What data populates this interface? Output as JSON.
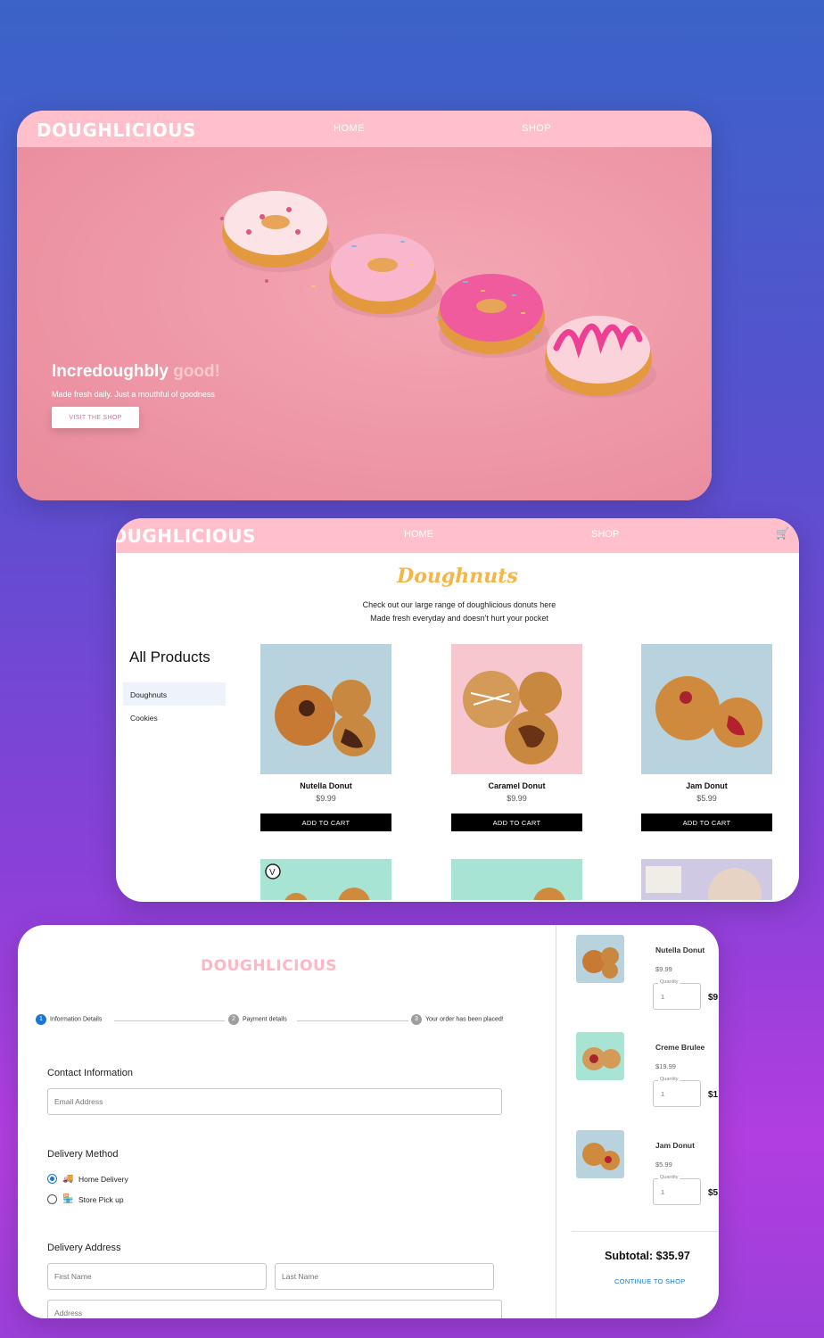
{
  "hero": {
    "brand": "DOUGHLICIOUS",
    "nav": {
      "home": "HOME",
      "shop": "SHOP"
    },
    "headline_main": "Incredoughbly",
    "headline_accent": "good!",
    "subtitle": "Made fresh daily. Just a mouthful of goodness",
    "cta": "VISIT THE SHOP"
  },
  "shop": {
    "brand": "DOUGHLICIOUS",
    "nav": {
      "home": "HOME",
      "shop": "SHOP"
    },
    "title": "Doughnuts",
    "desc_line1": "Check out our large range of doughlicious donuts here",
    "desc_line2": "Made fresh everyday and doesn't hurt your pocket",
    "categories_title": "All Products",
    "categories": [
      {
        "label": "Doughnuts",
        "active": true
      },
      {
        "label": "Cookies",
        "active": false
      }
    ],
    "products": [
      {
        "name": "Nutella Donut",
        "price": "$9.99",
        "button": "ADD TO CART"
      },
      {
        "name": "Caramel Donut",
        "price": "$9.99",
        "button": "ADD TO CART"
      },
      {
        "name": "Jam Donut",
        "price": "$5.99",
        "button": "ADD TO CART"
      }
    ]
  },
  "checkout": {
    "brand": "DOUGHLICIOUS",
    "steps": [
      {
        "num": "1",
        "label": "Information Details"
      },
      {
        "num": "2",
        "label": "Payment details"
      },
      {
        "num": "3",
        "label": "Your order has been placed!"
      }
    ],
    "contact_title": "Contact Information",
    "email_placeholder": "Email Address",
    "delivery_title": "Delivery Method",
    "delivery_options": [
      {
        "label": "Home Delivery",
        "selected": true
      },
      {
        "label": "Store Pick up",
        "selected": false
      }
    ],
    "address_title": "Delivery Address",
    "first_name_placeholder": "First Name",
    "last_name_placeholder": "Last Name",
    "address_placeholder": "Address",
    "cart": [
      {
        "name": "Nutella Donut",
        "price": "$9.99",
        "qty_label": "Quantity",
        "qty": "1",
        "total": "$9"
      },
      {
        "name": "Creme Brulee",
        "price": "$19.99",
        "qty_label": "Quantity",
        "qty": "1",
        "total": "$1"
      },
      {
        "name": "Jam Donut",
        "price": "$5.99",
        "qty_label": "Quantity",
        "qty": "1",
        "total": "$5"
      }
    ],
    "subtotal": "Subtotal: $35.97",
    "continue": "CONTINUE TO SHOP"
  },
  "colors": {
    "brand_pink": "#ffc0cb",
    "hero_pink": "#ee97a6",
    "accent_yellow": "#f5b647",
    "primary_blue": "#1976d2"
  }
}
